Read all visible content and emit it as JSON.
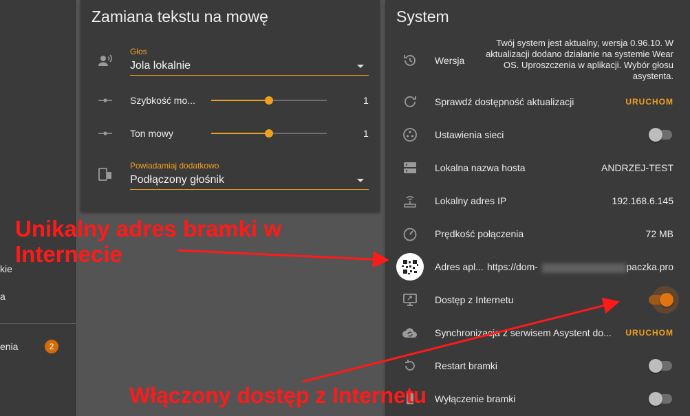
{
  "drawer": {
    "items": [
      {
        "label": "kie"
      },
      {
        "label": "a"
      },
      {
        "label": "enia",
        "badge": "2"
      }
    ]
  },
  "tts": {
    "title": "Zamiana tekstu na mowę",
    "voice": {
      "label": "Głos",
      "value": "Jola lokalnie"
    },
    "speed": {
      "label": "Szybkość mo...",
      "value": "1",
      "level": 0.5
    },
    "pitch": {
      "label": "Ton mowy",
      "value": "1",
      "level": 0.5
    },
    "notify": {
      "label": "Powiadamiaj dodatkowo",
      "value": "Podłączony głośnik"
    }
  },
  "system": {
    "title": "System",
    "rows": {
      "version": {
        "label": "Wersja",
        "value": "Twój system jest aktualny, wersja 0.96.10. W aktualizacji dodano działanie na systemie Wear OS. Uproszczenia w aplikacji. Wybór głosu asystenta."
      },
      "update": {
        "label": "Sprawdź dostępność aktualizacji",
        "action": "URUCHOM"
      },
      "network": {
        "label": "Ustawienia sieci",
        "on": false
      },
      "hostname": {
        "label": "Lokalna nazwa hosta",
        "value": "ANDRZEJ-TEST"
      },
      "ip": {
        "label": "Lokalny adres IP",
        "value": "192.168.6.145"
      },
      "speed": {
        "label": "Prędkość połączenia",
        "value": "72 MB"
      },
      "address": {
        "label": "Adres apl...",
        "value_start": "https://dom-",
        "value_end": "paczka.pro"
      },
      "internet": {
        "label": "Dostęp z Internetu",
        "on": true
      },
      "sync": {
        "label": "Synchronizacja z serwisem Asystent do...",
        "action": "URUCHOM"
      },
      "restart": {
        "label": "Restart bramki",
        "on": false
      },
      "shutdown": {
        "label": "Wyłączenie bramki",
        "on": false
      }
    }
  },
  "annotations": {
    "gateway": {
      "line1": "Unikalny adres bramki w",
      "line2": "Internecie"
    },
    "access": {
      "text": "Włączony dostęp z Internetu"
    },
    "color": "#ff1a1a"
  },
  "colors": {
    "accent": "#f0a020",
    "card": "#3a3a3a",
    "background": "#545454"
  }
}
